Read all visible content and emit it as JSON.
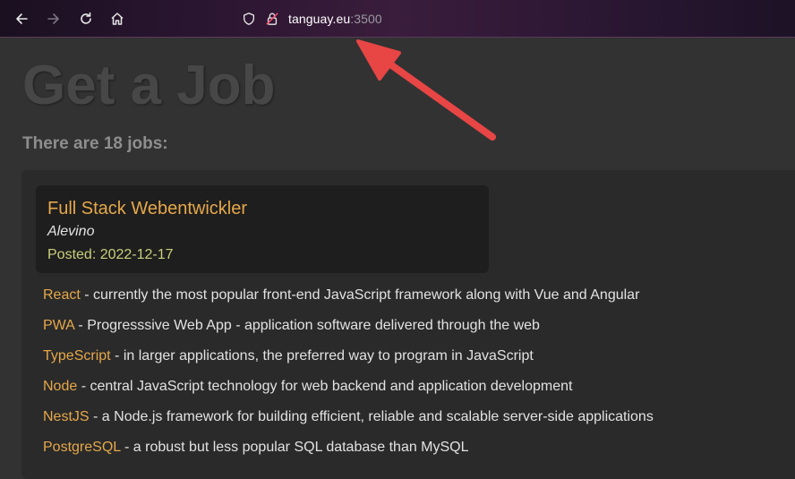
{
  "browser": {
    "url_host": "tanguay.eu",
    "url_port": ":3500",
    "icons": [
      "back-arrow-icon",
      "forward-arrow-icon",
      "reload-icon",
      "home-icon",
      "shield-icon",
      "insecure-lock-icon"
    ]
  },
  "page": {
    "title": "Get a Job",
    "jobs_count": "There are 18 jobs:"
  },
  "job": {
    "title": "Full Stack Webentwickler",
    "company": "Alevino",
    "posted": "Posted: 2022-12-17",
    "skills": [
      {
        "name": "React",
        "description": " - currently the most popular front-end JavaScript framework along with Vue and Angular"
      },
      {
        "name": "PWA",
        "description": " - Progresssive Web App - application software delivered through the web"
      },
      {
        "name": "TypeScript",
        "description": " - in larger applications, the preferred way to program in JavaScript"
      },
      {
        "name": "Node",
        "description": " - central JavaScript technology for web backend and application development"
      },
      {
        "name": "NestJS",
        "description": " - a Node.js framework for building efficient, reliable and scalable server-side applications"
      },
      {
        "name": "PostgreSQL",
        "description": " - a robust but less popular SQL database than MySQL"
      }
    ]
  },
  "colors": {
    "accent": "#e6a84a",
    "posted": "#c9cf7a",
    "annotation_arrow": "#e84545"
  }
}
